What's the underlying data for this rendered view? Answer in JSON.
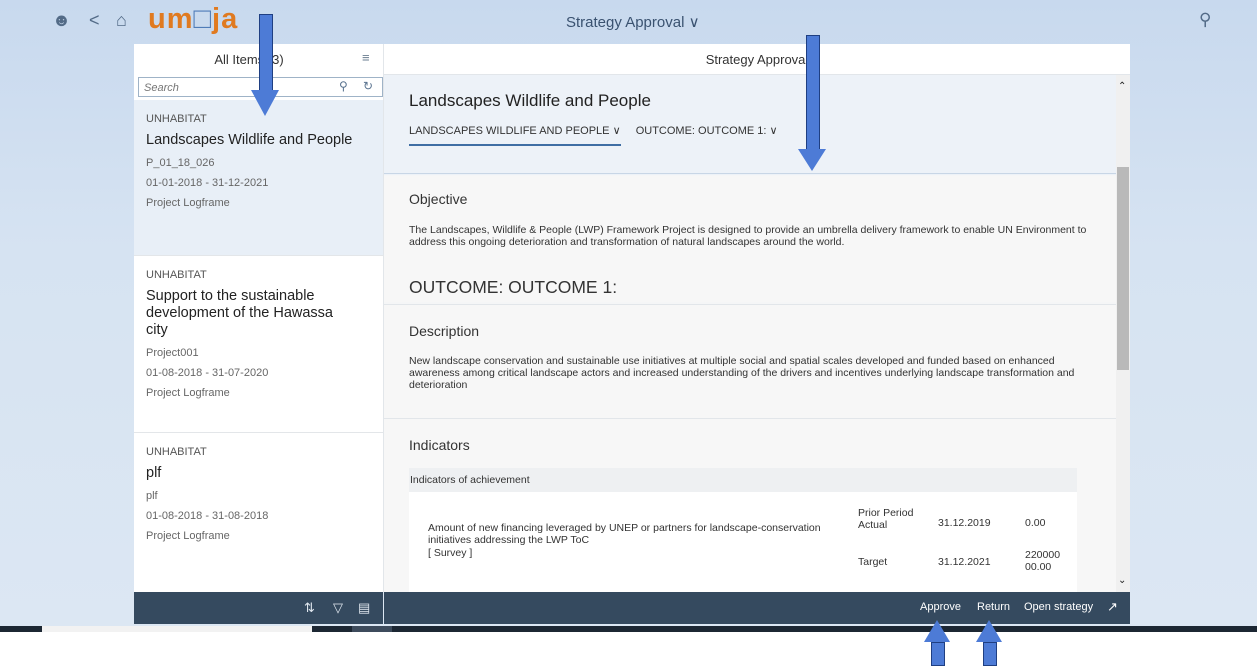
{
  "shell": {
    "logo_left": "um",
    "logo_mid": "□",
    "logo_right": "ja",
    "title": "Strategy Approval ∨"
  },
  "master": {
    "title": "All Items (3)",
    "search_placeholder": "Search",
    "items": [
      {
        "org": "UNHABITAT",
        "title": "Landscapes Wildlife and People",
        "code": "P_01_18_026",
        "dates": "01-01-2018 - 31-12-2021",
        "type": "Project Logframe"
      },
      {
        "org": "UNHABITAT",
        "title": "Support to the sustainable development of the Hawassa city",
        "code": "Project001",
        "dates": "01-08-2018 - 31-07-2020",
        "type": "Project Logframe"
      },
      {
        "org": "UNHABITAT",
        "title": "plf",
        "code": "plf",
        "dates": "01-08-2018 - 31-08-2018",
        "type": "Project Logframe"
      }
    ]
  },
  "detail": {
    "header_title": "Strategy Approval",
    "object_title": "Landscapes Wildlife and People",
    "tabs": [
      "LANDSCAPES WILDLIFE AND PEOPLE ∨",
      "OUTCOME: OUTCOME 1: ∨"
    ],
    "objective_title": "Objective",
    "objective_text": "The Landscapes, Wildlife & People (LWP) Framework Project is designed to provide an umbrella delivery framework to enable UN Environment to address this ongoing deterioration and transformation of natural landscapes around the world.",
    "outcome_title": "OUTCOME: OUTCOME 1:",
    "description_title": "Description",
    "description_text": "New landscape conservation and sustainable use initiatives at multiple social and spatial scales developed and funded based on enhanced awareness among critical landscape actors and increased understanding of the drivers and incentives underlying landscape transformation and deterioration",
    "indicators_title": "Indicators",
    "indicators_table_header": "Indicators of achievement",
    "indicator": {
      "text": "Amount of new financing leveraged by UNEP or partners for landscape-conservation initiatives addressing the LWP ToC",
      "source": "[ Survey ]",
      "rows": [
        {
          "label": "Prior Period Actual",
          "date": "31.12.2019",
          "value": "0.00"
        },
        {
          "label": "Target",
          "date": "31.12.2021",
          "value": "22000000.00"
        }
      ]
    }
  },
  "footer": {
    "approve": "Approve",
    "return": "Return",
    "open_strategy": "Open strategy"
  },
  "colors": {
    "logo_orange": "#e07a20",
    "footer_bg": "#354a5f",
    "annotation_arrow": "#4d7bd6"
  }
}
